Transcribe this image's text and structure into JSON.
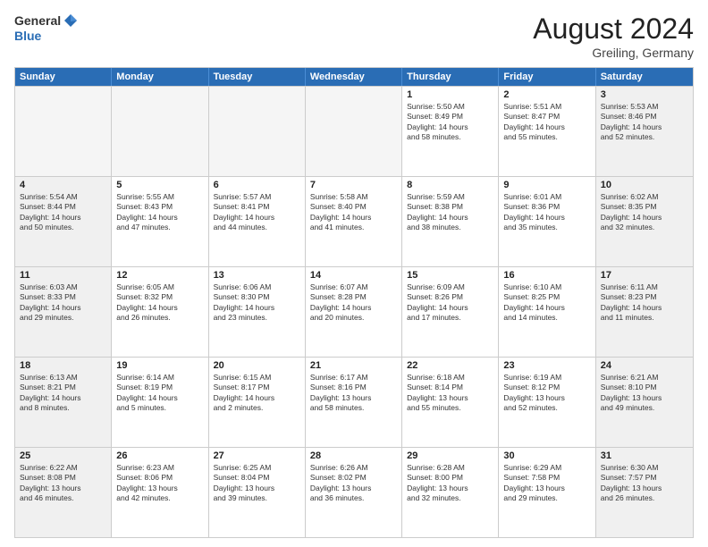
{
  "header": {
    "logo_general": "General",
    "logo_blue": "Blue",
    "month": "August 2024",
    "location": "Greiling, Germany"
  },
  "calendar": {
    "weekdays": [
      "Sunday",
      "Monday",
      "Tuesday",
      "Wednesday",
      "Thursday",
      "Friday",
      "Saturday"
    ],
    "rows": [
      [
        {
          "day": "",
          "empty": true
        },
        {
          "day": "",
          "empty": true
        },
        {
          "day": "",
          "empty": true
        },
        {
          "day": "",
          "empty": true
        },
        {
          "day": "1",
          "lines": [
            "Sunrise: 5:50 AM",
            "Sunset: 8:49 PM",
            "Daylight: 14 hours",
            "and 58 minutes."
          ]
        },
        {
          "day": "2",
          "lines": [
            "Sunrise: 5:51 AM",
            "Sunset: 8:47 PM",
            "Daylight: 14 hours",
            "and 55 minutes."
          ]
        },
        {
          "day": "3",
          "shaded": true,
          "lines": [
            "Sunrise: 5:53 AM",
            "Sunset: 8:46 PM",
            "Daylight: 14 hours",
            "and 52 minutes."
          ]
        }
      ],
      [
        {
          "day": "4",
          "shaded": true,
          "lines": [
            "Sunrise: 5:54 AM",
            "Sunset: 8:44 PM",
            "Daylight: 14 hours",
            "and 50 minutes."
          ]
        },
        {
          "day": "5",
          "lines": [
            "Sunrise: 5:55 AM",
            "Sunset: 8:43 PM",
            "Daylight: 14 hours",
            "and 47 minutes."
          ]
        },
        {
          "day": "6",
          "lines": [
            "Sunrise: 5:57 AM",
            "Sunset: 8:41 PM",
            "Daylight: 14 hours",
            "and 44 minutes."
          ]
        },
        {
          "day": "7",
          "lines": [
            "Sunrise: 5:58 AM",
            "Sunset: 8:40 PM",
            "Daylight: 14 hours",
            "and 41 minutes."
          ]
        },
        {
          "day": "8",
          "lines": [
            "Sunrise: 5:59 AM",
            "Sunset: 8:38 PM",
            "Daylight: 14 hours",
            "and 38 minutes."
          ]
        },
        {
          "day": "9",
          "lines": [
            "Sunrise: 6:01 AM",
            "Sunset: 8:36 PM",
            "Daylight: 14 hours",
            "and 35 minutes."
          ]
        },
        {
          "day": "10",
          "shaded": true,
          "lines": [
            "Sunrise: 6:02 AM",
            "Sunset: 8:35 PM",
            "Daylight: 14 hours",
            "and 32 minutes."
          ]
        }
      ],
      [
        {
          "day": "11",
          "shaded": true,
          "lines": [
            "Sunrise: 6:03 AM",
            "Sunset: 8:33 PM",
            "Daylight: 14 hours",
            "and 29 minutes."
          ]
        },
        {
          "day": "12",
          "lines": [
            "Sunrise: 6:05 AM",
            "Sunset: 8:32 PM",
            "Daylight: 14 hours",
            "and 26 minutes."
          ]
        },
        {
          "day": "13",
          "lines": [
            "Sunrise: 6:06 AM",
            "Sunset: 8:30 PM",
            "Daylight: 14 hours",
            "and 23 minutes."
          ]
        },
        {
          "day": "14",
          "lines": [
            "Sunrise: 6:07 AM",
            "Sunset: 8:28 PM",
            "Daylight: 14 hours",
            "and 20 minutes."
          ]
        },
        {
          "day": "15",
          "lines": [
            "Sunrise: 6:09 AM",
            "Sunset: 8:26 PM",
            "Daylight: 14 hours",
            "and 17 minutes."
          ]
        },
        {
          "day": "16",
          "lines": [
            "Sunrise: 6:10 AM",
            "Sunset: 8:25 PM",
            "Daylight: 14 hours",
            "and 14 minutes."
          ]
        },
        {
          "day": "17",
          "shaded": true,
          "lines": [
            "Sunrise: 6:11 AM",
            "Sunset: 8:23 PM",
            "Daylight: 14 hours",
            "and 11 minutes."
          ]
        }
      ],
      [
        {
          "day": "18",
          "shaded": true,
          "lines": [
            "Sunrise: 6:13 AM",
            "Sunset: 8:21 PM",
            "Daylight: 14 hours",
            "and 8 minutes."
          ]
        },
        {
          "day": "19",
          "lines": [
            "Sunrise: 6:14 AM",
            "Sunset: 8:19 PM",
            "Daylight: 14 hours",
            "and 5 minutes."
          ]
        },
        {
          "day": "20",
          "lines": [
            "Sunrise: 6:15 AM",
            "Sunset: 8:17 PM",
            "Daylight: 14 hours",
            "and 2 minutes."
          ]
        },
        {
          "day": "21",
          "lines": [
            "Sunrise: 6:17 AM",
            "Sunset: 8:16 PM",
            "Daylight: 13 hours",
            "and 58 minutes."
          ]
        },
        {
          "day": "22",
          "lines": [
            "Sunrise: 6:18 AM",
            "Sunset: 8:14 PM",
            "Daylight: 13 hours",
            "and 55 minutes."
          ]
        },
        {
          "day": "23",
          "lines": [
            "Sunrise: 6:19 AM",
            "Sunset: 8:12 PM",
            "Daylight: 13 hours",
            "and 52 minutes."
          ]
        },
        {
          "day": "24",
          "shaded": true,
          "lines": [
            "Sunrise: 6:21 AM",
            "Sunset: 8:10 PM",
            "Daylight: 13 hours",
            "and 49 minutes."
          ]
        }
      ],
      [
        {
          "day": "25",
          "shaded": true,
          "lines": [
            "Sunrise: 6:22 AM",
            "Sunset: 8:08 PM",
            "Daylight: 13 hours",
            "and 46 minutes."
          ]
        },
        {
          "day": "26",
          "lines": [
            "Sunrise: 6:23 AM",
            "Sunset: 8:06 PM",
            "Daylight: 13 hours",
            "and 42 minutes."
          ]
        },
        {
          "day": "27",
          "lines": [
            "Sunrise: 6:25 AM",
            "Sunset: 8:04 PM",
            "Daylight: 13 hours",
            "and 39 minutes."
          ]
        },
        {
          "day": "28",
          "lines": [
            "Sunrise: 6:26 AM",
            "Sunset: 8:02 PM",
            "Daylight: 13 hours",
            "and 36 minutes."
          ]
        },
        {
          "day": "29",
          "lines": [
            "Sunrise: 6:28 AM",
            "Sunset: 8:00 PM",
            "Daylight: 13 hours",
            "and 32 minutes."
          ]
        },
        {
          "day": "30",
          "lines": [
            "Sunrise: 6:29 AM",
            "Sunset: 7:58 PM",
            "Daylight: 13 hours",
            "and 29 minutes."
          ]
        },
        {
          "day": "31",
          "shaded": true,
          "lines": [
            "Sunrise: 6:30 AM",
            "Sunset: 7:57 PM",
            "Daylight: 13 hours",
            "and 26 minutes."
          ]
        }
      ]
    ]
  }
}
